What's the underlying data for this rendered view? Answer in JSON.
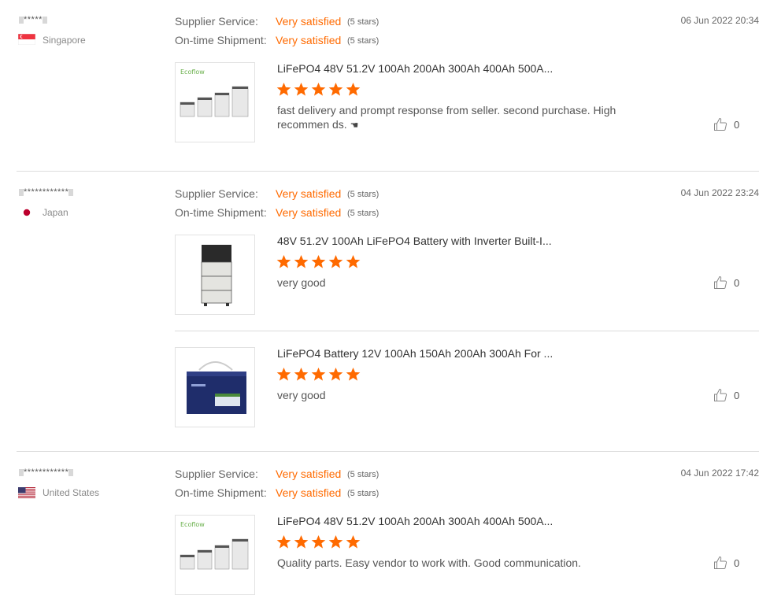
{
  "reviews": [
    {
      "user": "*****",
      "country": "Singapore",
      "date": "06 Jun 2022 20:34",
      "supplier_label": "Supplier Service:",
      "supplier_value": "Very satisfied",
      "supplier_stars": "(5 stars)",
      "shipment_label": "On-time Shipment:",
      "shipment_value": "Very satisfied",
      "shipment_stars": "(5 stars)",
      "products": [
        {
          "title": "LiFePO4 48V 51.2V 100Ah 200Ah 300Ah 400Ah 500A...",
          "rating": 5,
          "comment": "fast delivery and prompt response from seller. second purchase. High recommen ds.",
          "image": "battery-rack-image",
          "likes": "0"
        }
      ]
    },
    {
      "user": "************",
      "country": "Japan",
      "date": "04 Jun 2022 23:24",
      "supplier_label": "Supplier Service:",
      "supplier_value": "Very satisfied",
      "supplier_stars": "(5 stars)",
      "shipment_label": "On-time Shipment:",
      "shipment_value": "Very satisfied",
      "shipment_stars": "(5 stars)",
      "products": [
        {
          "title": "48V 51.2V 100Ah LiFePO4 Battery with Inverter Built-I...",
          "rating": 5,
          "comment": "very good",
          "image": "stacked-battery-image",
          "likes": "0"
        },
        {
          "title": "LiFePO4 Battery 12V 100Ah 150Ah 200Ah 300Ah For ...",
          "rating": 5,
          "comment": "very good",
          "image": "12v-battery-image",
          "likes": "0"
        }
      ]
    },
    {
      "user": "************",
      "country": "United States",
      "date": "04 Jun 2022 17:42",
      "supplier_label": "Supplier Service:",
      "supplier_value": "Very satisfied",
      "supplier_stars": "(5 stars)",
      "shipment_label": "On-time Shipment:",
      "shipment_value": "Very satisfied",
      "shipment_stars": "(5 stars)",
      "products": [
        {
          "title": "LiFePO4 48V 51.2V 100Ah 200Ah 300Ah 400Ah 500A...",
          "rating": 5,
          "comment": "Quality parts. Easy vendor to work with. Good communication.",
          "image": "battery-rack-image",
          "likes": "0"
        }
      ]
    }
  ],
  "colors": {
    "accent": "#ff6a00",
    "divider": "#dcdcdc",
    "text": "#333333",
    "muted": "#666666"
  }
}
